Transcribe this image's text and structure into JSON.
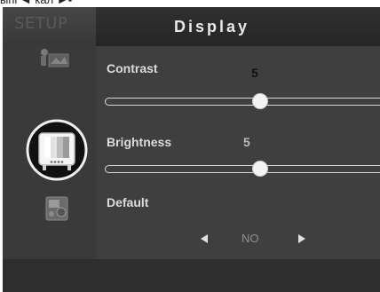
{
  "caption_fragment": "ыпі  ◄ кал ►▪",
  "header": {
    "setup_label": "SETUP",
    "title": "Display"
  },
  "sidebar": {
    "items": [
      {
        "icon": "picture-settings-icon",
        "selected": false
      },
      {
        "icon": "tv-display-icon",
        "selected": true
      },
      {
        "icon": "audio-settings-icon",
        "selected": false
      }
    ]
  },
  "settings": {
    "contrast": {
      "label": "Contrast",
      "value": "5",
      "level": 0.55
    },
    "brightness": {
      "label": "Brightness",
      "value": "5",
      "level": 0.55
    },
    "default": {
      "label": "Default",
      "value": "NO"
    }
  },
  "colors": {
    "background": "#3f3f3f",
    "header": "#2a2a2a",
    "text": "#dcdcdc",
    "value_contrast": "#111111",
    "value_brightness": "#bdbdbd"
  }
}
